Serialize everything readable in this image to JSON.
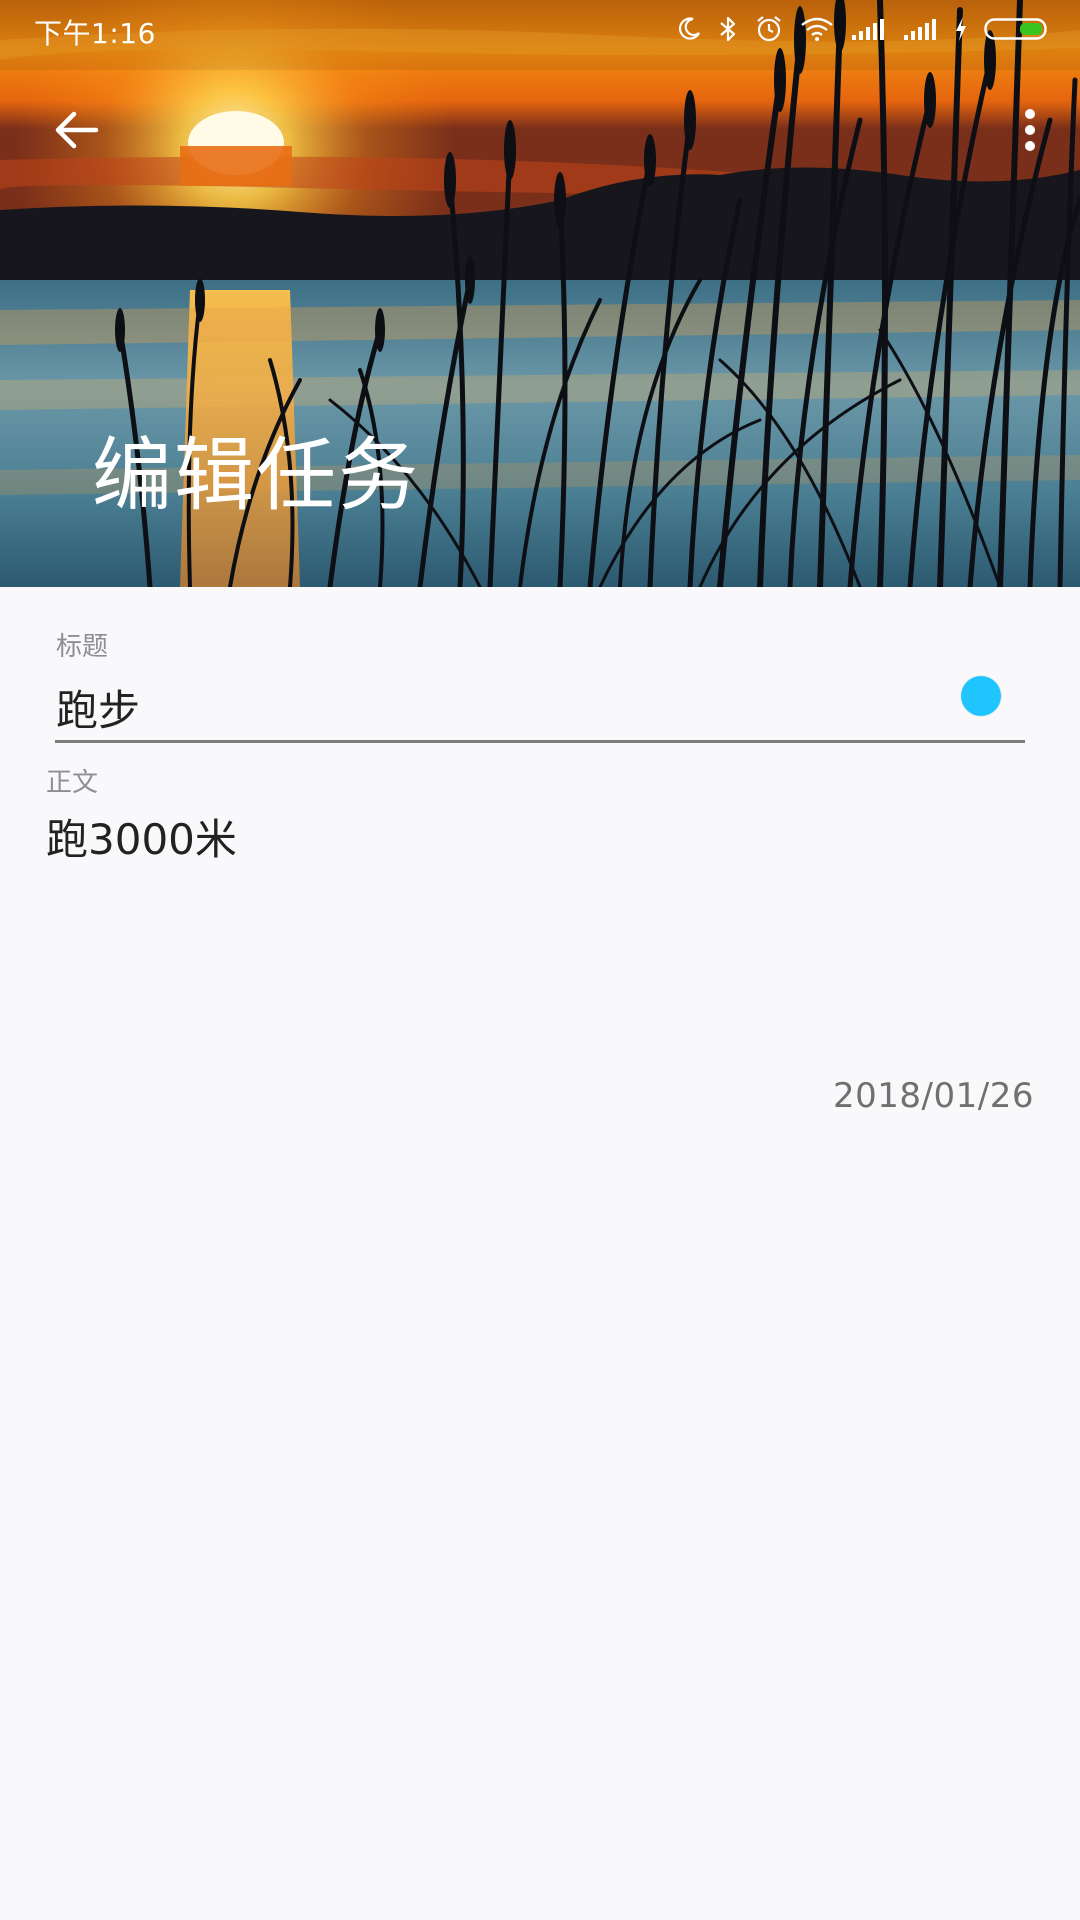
{
  "status_bar": {
    "time": "下午1:16",
    "icons": [
      "moon-icon",
      "bluetooth-icon",
      "alarm-icon",
      "wifi-icon",
      "signal-icon",
      "signal-icon",
      "charging-icon",
      "battery-icon"
    ],
    "battery_color": "#3ac41f"
  },
  "toolbar": {
    "back_icon": "arrow-left-icon",
    "more_icon": "more-vert-icon",
    "title": "编辑任务"
  },
  "form": {
    "title_label": "标题",
    "title_value": "跑步",
    "title_color": "#1ec5ff",
    "body_label": "正文",
    "body_value": "跑3000米",
    "date": "2018/01/26"
  }
}
